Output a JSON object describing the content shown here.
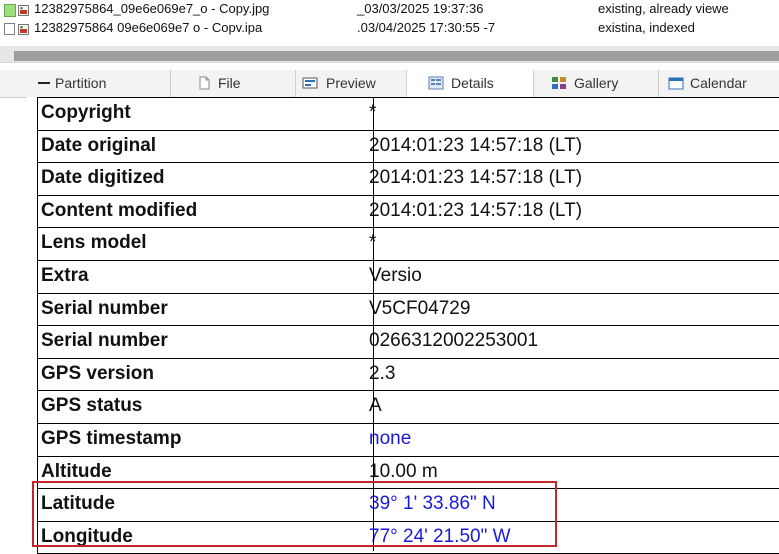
{
  "files": [
    {
      "name": "12382975864_09e6e069e7_o - Copy.jpg",
      "date": "_03/03/2025 19:37:36",
      "status": "existing, already viewe",
      "selected": true
    },
    {
      "name": "12382975864 09e6e069e7 o - Copv.ipa",
      "date": ".03/04/2025 17:30:55 -7",
      "status": "existina, indexed",
      "selected": false
    }
  ],
  "tabs": [
    {
      "label": "Partition",
      "icon": "partition-icon"
    },
    {
      "label": "File",
      "icon": "file-icon"
    },
    {
      "label": "Preview",
      "icon": "preview-icon"
    },
    {
      "label": "Details",
      "icon": "details-icon"
    },
    {
      "label": "Gallery",
      "icon": "gallery-icon"
    },
    {
      "label": "Calendar",
      "icon": "calendar-icon"
    }
  ],
  "details": [
    {
      "key": "Copyright",
      "value": "*"
    },
    {
      "key": "Date original",
      "value": "2014:01:23 14:57:18 (LT)"
    },
    {
      "key": "Date digitized",
      "value": "2014:01:23 14:57:18 (LT)"
    },
    {
      "key": "Content modified",
      "value": "2014:01:23 14:57:18 (LT)"
    },
    {
      "key": "Lens model",
      "value": "*"
    },
    {
      "key": "Extra",
      "value": "Versio"
    },
    {
      "key": "Serial number",
      "value": "V5CF04729"
    },
    {
      "key": "Serial number",
      "value": "0266312002253001"
    },
    {
      "key": "GPS version",
      "value": "2.3"
    },
    {
      "key": "GPS status",
      "value": "A"
    },
    {
      "key": "GPS timestamp",
      "value": "none",
      "link": true
    },
    {
      "key": "Altitude",
      "value": "10.00 m"
    },
    {
      "key": "Latitude",
      "value": "39° 1' 33.86\" N",
      "link": true
    },
    {
      "key": "Longitude",
      "value": "77° 24' 21.50\" W",
      "link": true
    }
  ],
  "colors": {
    "link": "#1a1adc",
    "highlight": "#c3272b",
    "selected": "#9be07a"
  }
}
